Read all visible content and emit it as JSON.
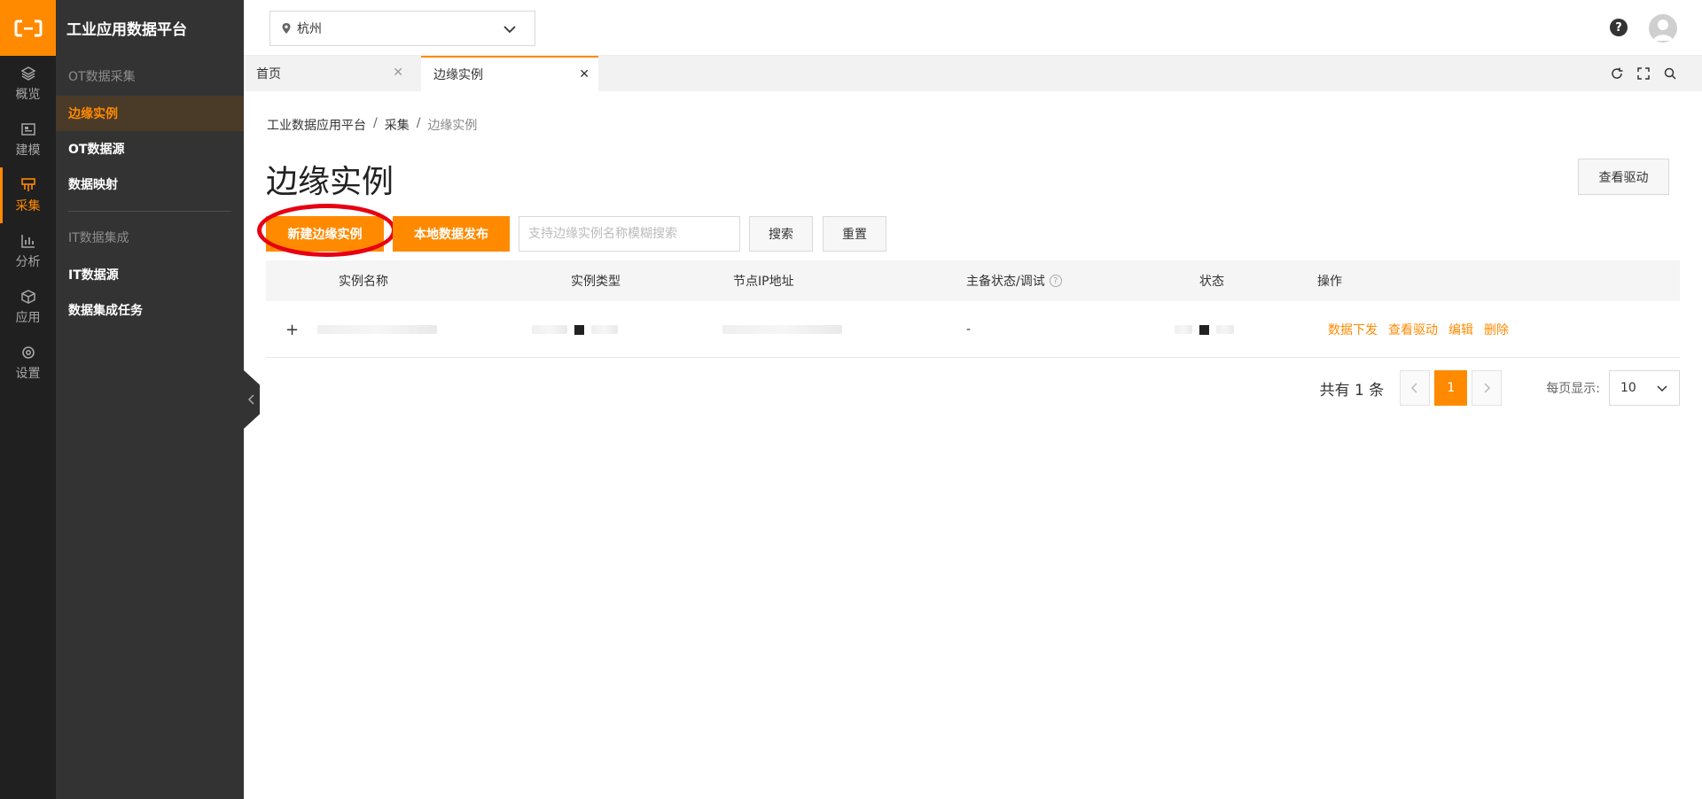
{
  "app": {
    "title": "工业应用数据平台",
    "brand_color": "#ff8a00"
  },
  "rail": {
    "items": [
      {
        "label": "概览",
        "icon": "layers-icon"
      },
      {
        "label": "建模",
        "icon": "model-icon"
      },
      {
        "label": "采集",
        "icon": "collect-icon",
        "active": true
      },
      {
        "label": "分析",
        "icon": "chart-icon"
      },
      {
        "label": "应用",
        "icon": "cube-icon"
      },
      {
        "label": "设置",
        "icon": "gear-icon"
      }
    ]
  },
  "sidebar": {
    "group1": "OT数据采集",
    "items1": [
      "边缘实例",
      "OT数据源",
      "数据映射"
    ],
    "group2": "IT数据集成",
    "items2": [
      "IT数据源",
      "数据集成任务"
    ]
  },
  "header": {
    "region": "杭州"
  },
  "tabs": [
    {
      "label": "首页"
    },
    {
      "label": "边缘实例",
      "active": true
    }
  ],
  "breadcrumb": {
    "level1": "工业数据应用平台",
    "level2": "采集",
    "level3": "边缘实例",
    "separator": "/"
  },
  "page": {
    "title": "边缘实例",
    "view_driver_button": "查看驱动"
  },
  "toolbar": {
    "new_instance_button": "新建边缘实例",
    "local_publish_button": "本地数据发布",
    "search_placeholder": "支持边缘实例名称模糊搜索",
    "search_button": "搜索",
    "reset_button": "重置"
  },
  "table": {
    "columns": [
      "实例名称",
      "实例类型",
      "节点IP地址",
      "主备状态/调试",
      "状态",
      "操作"
    ],
    "rows": [
      {
        "expand": "+",
        "standby_status": "-",
        "actions": [
          "数据下发",
          "查看驱动",
          "编辑",
          "删除"
        ]
      }
    ]
  },
  "pagination": {
    "total_text": "共有 1 条",
    "current_page": "1",
    "per_page_label": "每页显示:",
    "per_page_value": "10"
  }
}
